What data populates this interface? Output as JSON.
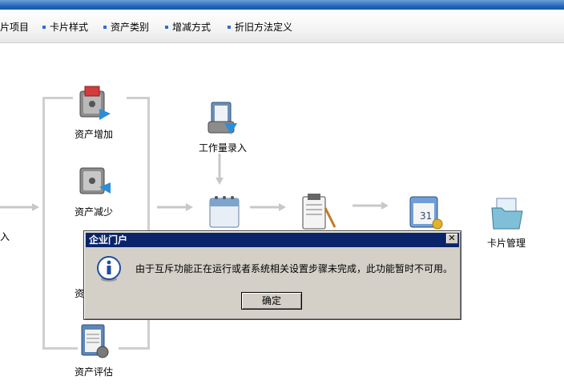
{
  "toolbar": {
    "items": [
      {
        "label": "片项目"
      },
      {
        "label": "卡片样式"
      },
      {
        "label": "资产类别"
      },
      {
        "label": "增减方式"
      },
      {
        "label": "折旧方法定义"
      }
    ]
  },
  "flow": {
    "left_cut_label": "入",
    "asset_add": "资产增加",
    "asset_reduce": "资产减少",
    "asset_hidden": "资",
    "asset_evaluate": "资产评估",
    "workload_entry": "工作量录入",
    "card_management": "卡片管理"
  },
  "dialog": {
    "title": "企业门户",
    "close": "✕",
    "message": "由于互斥功能正在运行或者系统相关设置步骤未完成，此功能暂时不可用。",
    "ok_label": "确定"
  },
  "colors": {
    "title_bar": "#0a246a",
    "dialog_bg": "#d4d0c8",
    "accent": "#2d6fd1"
  }
}
